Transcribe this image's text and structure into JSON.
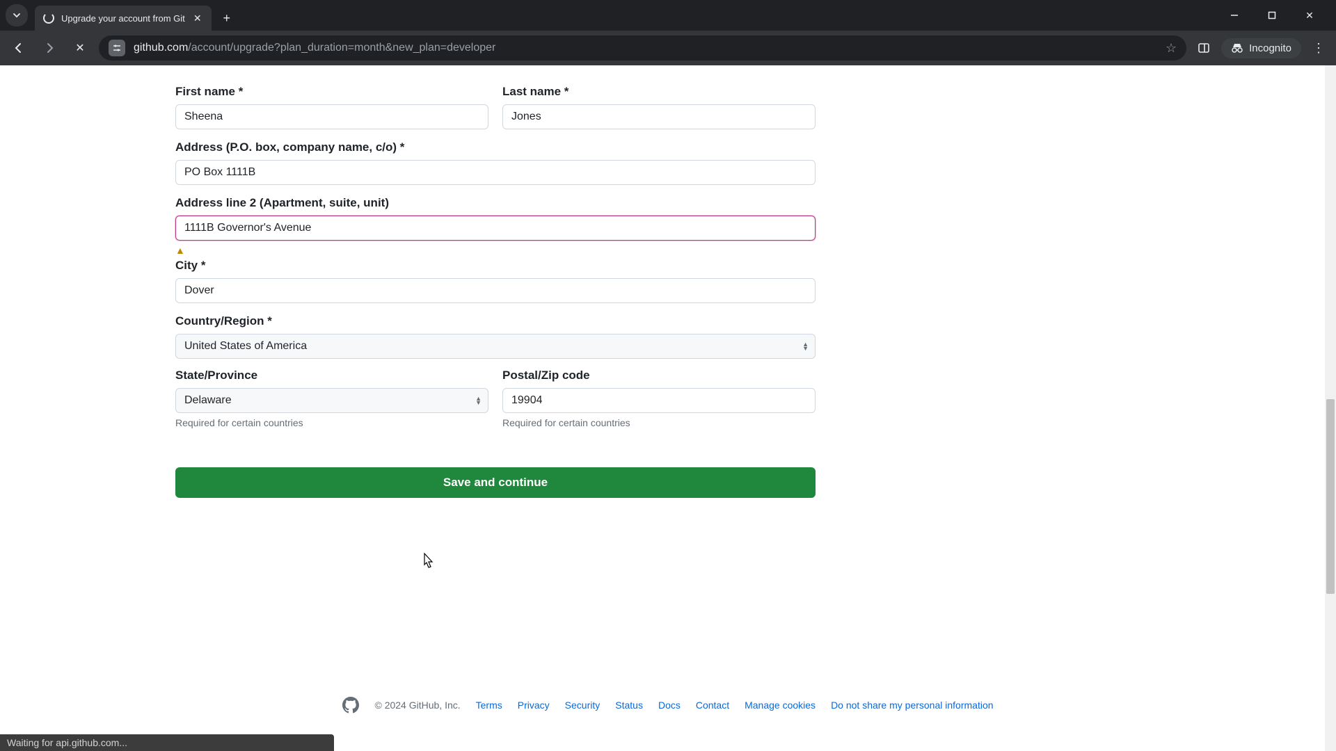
{
  "browser": {
    "tab_title": "Upgrade your account from Git",
    "url_host": "github.com",
    "url_path": "/account/upgrade?plan_duration=month&new_plan=developer",
    "incognito_label": "Incognito"
  },
  "form": {
    "first_name": {
      "label": "First name *",
      "value": "Sheena"
    },
    "last_name": {
      "label": "Last name *",
      "value": "Jones"
    },
    "address1": {
      "label": "Address (P.O. box, company name, c/o) *",
      "value": "PO Box 1111B"
    },
    "address2": {
      "label": "Address line 2 (Apartment, suite, unit)",
      "value": "1111B Governor's Avenue"
    },
    "city": {
      "label": "City *",
      "value": "Dover"
    },
    "country": {
      "label": "Country/Region *",
      "value": "United States of America"
    },
    "state": {
      "label": "State/Province",
      "value": "Delaware",
      "hint": "Required for certain countries"
    },
    "postal": {
      "label": "Postal/Zip code",
      "value": "19904",
      "hint": "Required for certain countries"
    },
    "submit": "Save and continue"
  },
  "footer": {
    "copyright": "© 2024 GitHub, Inc.",
    "links": [
      "Terms",
      "Privacy",
      "Security",
      "Status",
      "Docs",
      "Contact",
      "Manage cookies",
      "Do not share my personal information"
    ]
  },
  "status_bar": "Waiting for api.github.com..."
}
